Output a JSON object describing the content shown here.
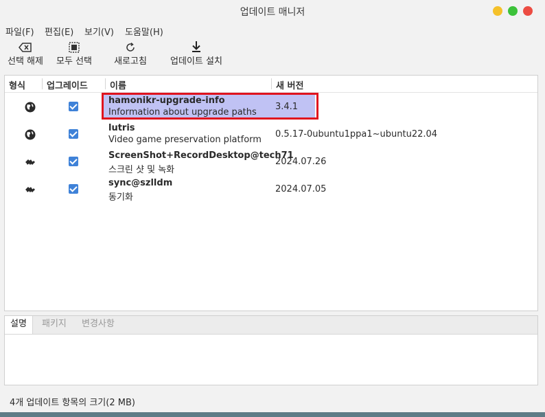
{
  "window": {
    "title": "업데이트 매니저"
  },
  "menu": {
    "items": [
      "파일(F)",
      "편집(E)",
      "보기(V)",
      "도움말(H)"
    ]
  },
  "toolbar": {
    "clear_label": "선택 해제",
    "select_all_label": "모두 선택",
    "refresh_label": "새로고침",
    "install_label": "업데이트 설치"
  },
  "columns": {
    "type": "형식",
    "upgrade": "업그레이드",
    "name": "이름",
    "new_version": "새 버전"
  },
  "updates": [
    {
      "icon": "globe-icon",
      "checked": true,
      "name": "hamonikr-upgrade-info",
      "description": "Information about upgrade paths",
      "version": "3.4.1",
      "selected": true
    },
    {
      "icon": "globe-icon",
      "checked": true,
      "name": "lutris",
      "description": "Video game preservation platform",
      "version": "0.5.17-0ubuntu1ppa1~ubuntu22.04",
      "selected": false
    },
    {
      "icon": "puzzle-icon",
      "checked": true,
      "name": "ScreenShot+RecordDesktop@tech71",
      "description": "스크린 샷 및 녹화",
      "version": "2024.07.26",
      "selected": false
    },
    {
      "icon": "puzzle-icon",
      "checked": true,
      "name": "sync@szlldm",
      "description": "동기화",
      "version": "2024.07.05",
      "selected": false
    }
  ],
  "tabs": {
    "description": "설명",
    "package": "패키지",
    "changelog": "변경사항"
  },
  "status": {
    "text": "4개 업데이트 항목의 크기(2 MB)"
  },
  "colors": {
    "selection": "#c0c2f4",
    "highlight_border": "#e0141e",
    "checkbox": "#3f82d8"
  }
}
